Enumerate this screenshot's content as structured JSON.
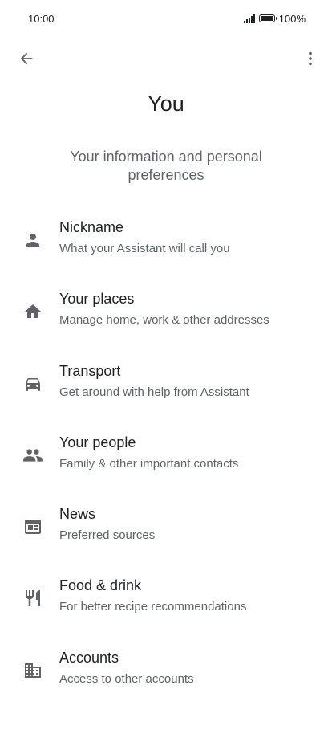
{
  "status_bar": {
    "time": "10:00",
    "battery": "100%"
  },
  "app_bar": {
    "back_icon": "arrow-back-icon",
    "more_icon": "more-vert-icon"
  },
  "page": {
    "title": "You",
    "subtitle": "Your information and personal preferences"
  },
  "items": [
    {
      "icon": "person-icon",
      "title": "Nickname",
      "description": "What your Assistant will call you"
    },
    {
      "icon": "home-icon",
      "title": "Your places",
      "description": "Manage home, work & other addresses"
    },
    {
      "icon": "car-icon",
      "title": "Transport",
      "description": "Get around with help from Assistant"
    },
    {
      "icon": "people-icon",
      "title": "Your people",
      "description": "Family & other important contacts"
    },
    {
      "icon": "news-icon",
      "title": "News",
      "description": "Preferred sources"
    },
    {
      "icon": "restaurant-icon",
      "title": "Food & drink",
      "description": "For better recipe recommendations"
    },
    {
      "icon": "business-icon",
      "title": "Accounts",
      "description": "Access to other accounts"
    }
  ],
  "colors": {
    "primary_text": "#202124",
    "secondary_text": "#5f6368",
    "icon": "#5f6368"
  }
}
